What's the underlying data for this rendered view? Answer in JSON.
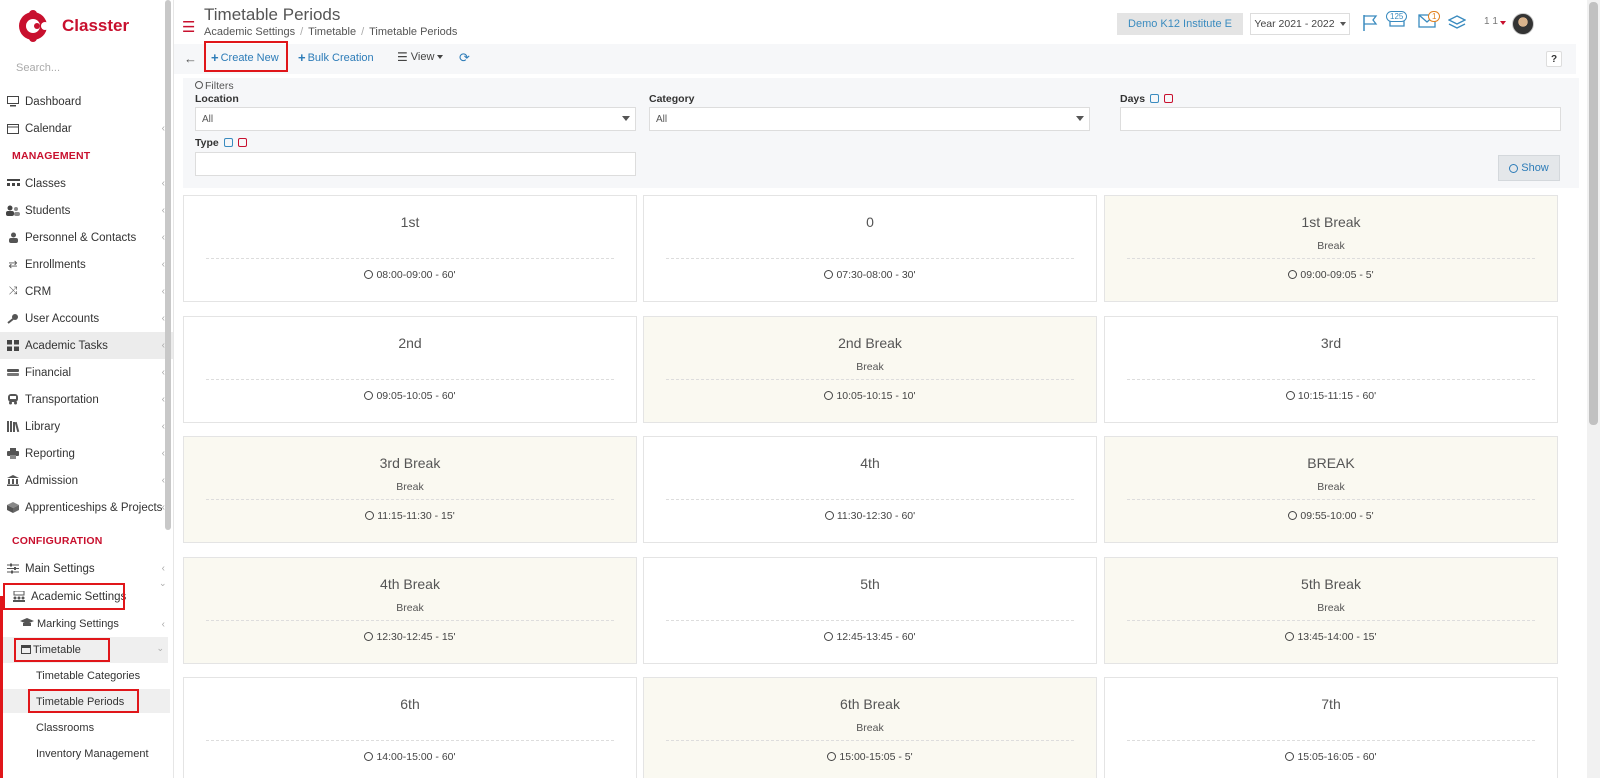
{
  "brand": {
    "name": "Classter"
  },
  "sidebar": {
    "search_placeholder": "Search...",
    "items": [
      {
        "label": "Dashboard",
        "icon": "monitor-icon"
      },
      {
        "label": "Calendar",
        "icon": "calendar-icon"
      }
    ],
    "management_title": "MANAGEMENT",
    "management_items": [
      {
        "label": "Classes"
      },
      {
        "label": "Students"
      },
      {
        "label": "Personnel & Contacts"
      },
      {
        "label": "Enrollments"
      },
      {
        "label": "CRM"
      },
      {
        "label": "User Accounts"
      },
      {
        "label": "Academic Tasks"
      },
      {
        "label": "Financial"
      },
      {
        "label": "Transportation"
      },
      {
        "label": "Library"
      },
      {
        "label": "Reporting"
      },
      {
        "label": "Admission"
      },
      {
        "label": "Apprenticeships & Projects"
      }
    ],
    "configuration_title": "CONFIGURATION",
    "config_items": [
      {
        "label": "Main Settings"
      },
      {
        "label": "Academic Settings"
      }
    ],
    "academic_sub": {
      "marking": "Marking Settings",
      "timetable": "Timetable",
      "timetable_sub": [
        "Timetable Categories",
        "Timetable Periods",
        "Classrooms",
        "Inventory Management"
      ]
    }
  },
  "header": {
    "title": "Timetable Periods",
    "breadcrumb": [
      "Academic Settings",
      "Timetable",
      "Timetable Periods"
    ],
    "institute": "Demo K12 Institute E",
    "year": "Year 2021 - 2022",
    "notifications_count": "125",
    "messages_count": "1",
    "user": "1 1"
  },
  "toolbar": {
    "create_new": "Create New",
    "bulk_creation": "Bulk Creation",
    "view": "View",
    "help": "?"
  },
  "filters": {
    "title": "Filters",
    "location_label": "Location",
    "location_value": "All",
    "category_label": "Category",
    "category_value": "All",
    "days_label": "Days",
    "type_label": "Type",
    "show_button": "Show"
  },
  "periods": [
    {
      "title": "1st",
      "type": "",
      "time": "08:00-09:00 - 60'",
      "is_break": false
    },
    {
      "title": "0",
      "type": "",
      "time": "07:30-08:00 - 30'",
      "is_break": false
    },
    {
      "title": "1st Break",
      "type": "Break",
      "time": "09:00-09:05 - 5'",
      "is_break": true
    },
    {
      "title": "2nd",
      "type": "",
      "time": "09:05-10:05 - 60'",
      "is_break": false
    },
    {
      "title": "2nd Break",
      "type": "Break",
      "time": "10:05-10:15 - 10'",
      "is_break": true
    },
    {
      "title": "3rd",
      "type": "",
      "time": "10:15-11:15 - 60'",
      "is_break": false
    },
    {
      "title": "3rd Break",
      "type": "Break",
      "time": "11:15-11:30 - 15'",
      "is_break": true
    },
    {
      "title": "4th",
      "type": "",
      "time": "11:30-12:30 - 60'",
      "is_break": false
    },
    {
      "title": "BREAK",
      "type": "Break",
      "time": "09:55-10:00 - 5'",
      "is_break": true
    },
    {
      "title": "4th Break",
      "type": "Break",
      "time": "12:30-12:45 - 15'",
      "is_break": true
    },
    {
      "title": "5th",
      "type": "",
      "time": "12:45-13:45 - 60'",
      "is_break": false
    },
    {
      "title": "5th Break",
      "type": "Break",
      "time": "13:45-14:00 - 15'",
      "is_break": true
    },
    {
      "title": "6th",
      "type": "",
      "time": "14:00-15:00 - 60'",
      "is_break": false
    },
    {
      "title": "6th Break",
      "type": "Break",
      "time": "15:00-15:05 - 5'",
      "is_break": true
    },
    {
      "title": "7th",
      "type": "",
      "time": "15:05-16:05 - 60'",
      "is_break": false
    }
  ],
  "colors": {
    "brand": "#c8102e",
    "accent": "#2d7cb8",
    "break_card": "#faf9f1",
    "highlight": "#e0161a"
  }
}
